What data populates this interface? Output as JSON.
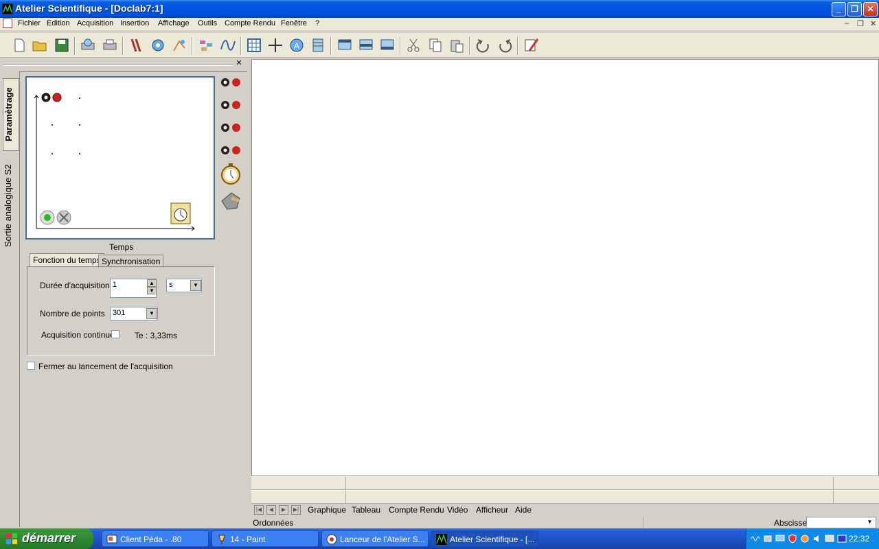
{
  "window": {
    "title": "Atelier Scientifique - [Doclab7:1]"
  },
  "menu": [
    "Fichier",
    "Edition",
    "Acquisition",
    "Insertion",
    "Affichage",
    "Outils",
    "Compte Rendu",
    "Fenêtre",
    "?"
  ],
  "side_tabs": {
    "active": "Paramètrage",
    "other": "Sortie analogique S2"
  },
  "preview": {
    "axis_label": "Temps"
  },
  "form": {
    "tabs": [
      "Fonction du temps",
      "Synchronisation"
    ],
    "duree_label": "Durée d'acquisition",
    "duree_value": "1",
    "duree_unit": "s",
    "points_label": "Nombre de points",
    "points_value": "301",
    "continue_label": "Acquisition continue",
    "te_text": "Te : 3,33ms",
    "fermer_label": "Fermer au lancement de l'acquisition"
  },
  "sheet_tabs": [
    "Graphique",
    "Tableau",
    "Compte Rendu",
    "Vidéo",
    "Afficheur",
    "Aide"
  ],
  "bottom": {
    "ordonnees": "Ordonnées",
    "abscisse": "Abscisse"
  },
  "taskbar": {
    "start": "démarrer",
    "tasks": [
      "Client Péda - .80",
      "14 - Paint",
      "Lanceur de l'Atelier S...",
      "Atelier Scientifique - [..."
    ],
    "clock": "22:32"
  },
  "colors": {
    "titlebar": "#0053e1",
    "taskbar": "#245edb",
    "start": "#2f8a2f",
    "accent": "#3a6ea5"
  }
}
